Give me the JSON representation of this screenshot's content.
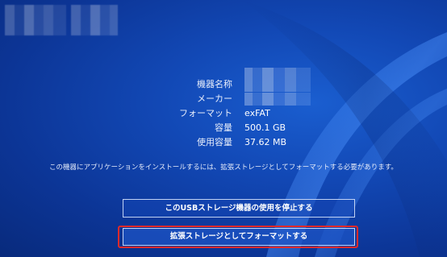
{
  "device_info": [
    {
      "label": "機器名称",
      "value": ""
    },
    {
      "label": "メーカー",
      "value": ""
    },
    {
      "label": "フォーマット",
      "value": "exFAT"
    },
    {
      "label": "容量",
      "value": "500.1 GB"
    },
    {
      "label": "使用容量",
      "value": "37.62 MB"
    }
  ],
  "message": "この機器にアプリケーションをインストールするには、拡張ストレージとしてフォーマットする必要があります。",
  "buttons": {
    "stop_usage": "このUSBストレージ機器の使用を停止する",
    "format_extended": "拡張ストレージとしてフォーマットする"
  },
  "colors": {
    "background": "#1248b5",
    "highlight": "#e02a2a",
    "text": "#ffffff"
  }
}
